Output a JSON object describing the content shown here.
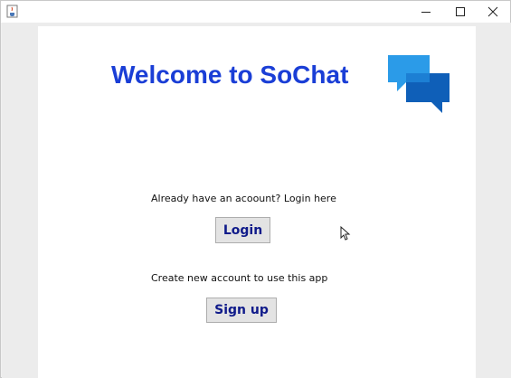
{
  "window": {
    "icon": "java-cup-icon",
    "controls": {
      "minimize": "minimize-icon",
      "maximize": "maximize-icon",
      "close": "close-icon"
    }
  },
  "main": {
    "welcome_title": "Welcome to SoChat",
    "logo_icon": "chat-bubbles-icon",
    "login_prompt": "Already have an acoount? Login here",
    "login_button": "Login",
    "signup_prompt": "Create new account to use this app",
    "signup_button": "Sign up"
  },
  "colors": {
    "title_blue": "#1a3ed6",
    "button_text": "#0f1a8a",
    "logo_light": "#2b9be8",
    "logo_dark": "#0f5fb8"
  }
}
